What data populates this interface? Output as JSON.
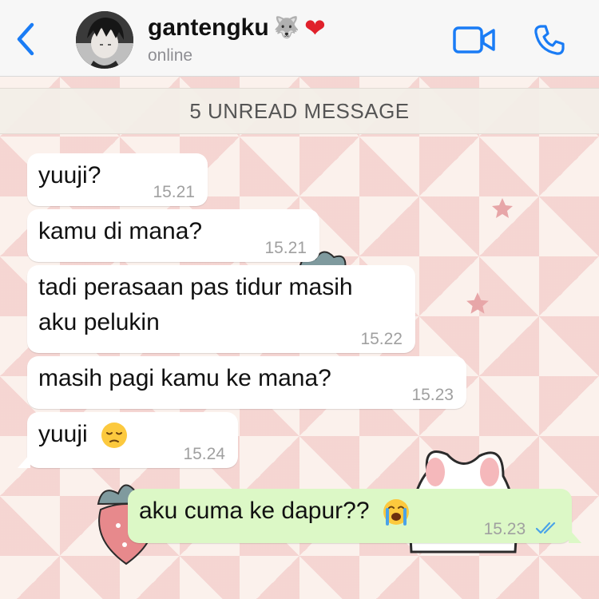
{
  "header": {
    "contact_name": "gantengku",
    "name_emoji_1": "🐺",
    "name_emoji_2": "❤",
    "status": "online",
    "colors": {
      "accent": "#1a7cf5",
      "heart": "#e0212b"
    }
  },
  "banner": {
    "text": "5 UNREAD MESSAGE"
  },
  "messages": [
    {
      "direction": "in",
      "text": "yuuji?",
      "time": "15.21"
    },
    {
      "direction": "in",
      "text": "kamu di mana?",
      "time": "15.21"
    },
    {
      "direction": "in",
      "text_line1": "tadi perasaan pas tidur masih",
      "text_line2": "aku pelukin",
      "time": "15.22"
    },
    {
      "direction": "in",
      "text": "masih pagi kamu ke mana?",
      "time": "15.23"
    },
    {
      "direction": "in",
      "text": "yuuji",
      "emoji": "pensive-face",
      "time": "15.24"
    },
    {
      "direction": "out",
      "text": "aku cuma ke dapur??",
      "emoji": "loudly-crying-face",
      "time": "15.23",
      "status": "read"
    }
  ],
  "icons": [
    "back-chevron-icon",
    "video-camera-icon",
    "phone-icon",
    "read-receipt-icon"
  ]
}
